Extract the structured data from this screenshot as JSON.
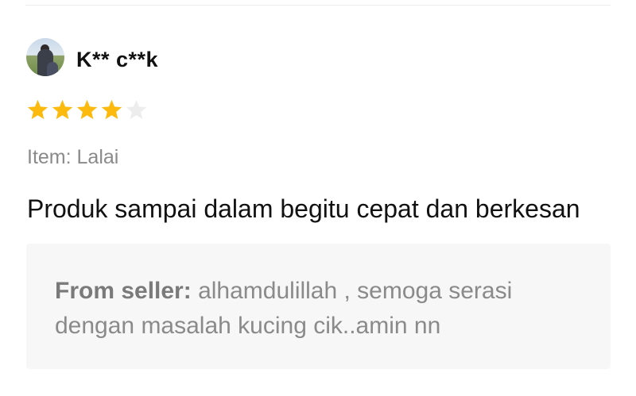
{
  "review": {
    "username": "K** c**k",
    "rating": 4,
    "rating_max": 5,
    "star_colors": {
      "filled": "#FDBA0E",
      "empty": "#EDEDED"
    },
    "item": "Item: Lalai",
    "text": "Produk sampai dalam begitu cepat dan berkesan",
    "seller_reply": {
      "label": "From seller:",
      "text": " alhamdulillah , semoga serasi dengan masalah kucing cik..amin nn"
    }
  }
}
